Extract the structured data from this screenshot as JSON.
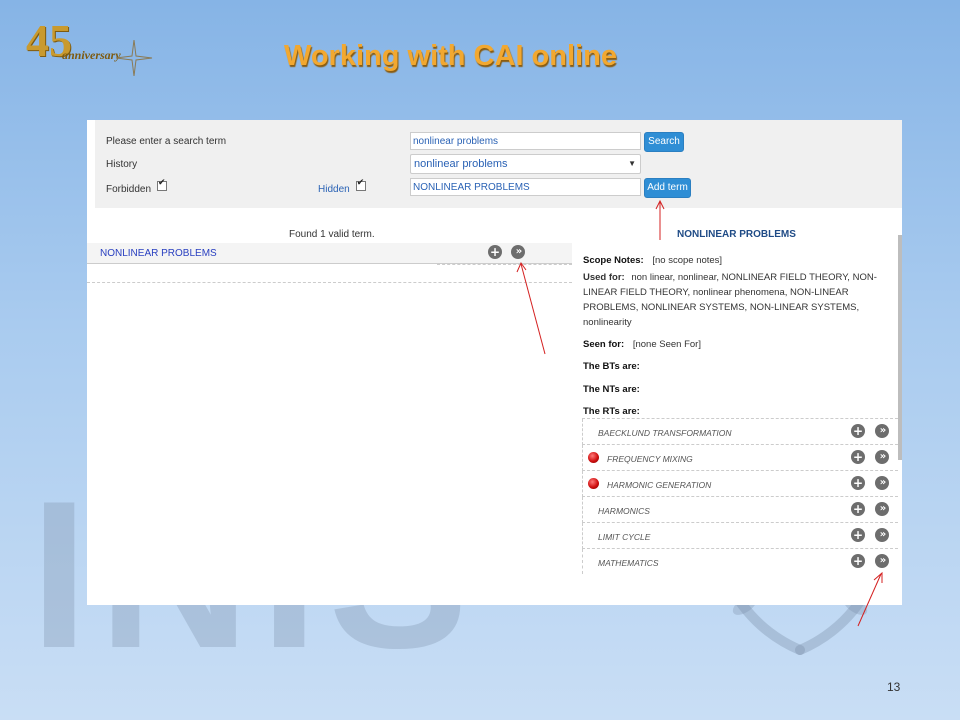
{
  "slide": {
    "title": "Working with CAI online",
    "page_number": "13"
  },
  "logo": {
    "number": "45",
    "word": "anniversary"
  },
  "background": {
    "letters": "INIS"
  },
  "search_form": {
    "search_label": "Please enter a search term",
    "search_value": "nonlinear problems",
    "search_button": "Search",
    "history_label": "History",
    "history_value": "nonlinear problems",
    "forbidden_label": "Forbidden",
    "hidden_label": "Hidden",
    "term_value": "NONLINEAR PROBLEMS",
    "add_term_button": "Add term"
  },
  "results": {
    "count_text": "Found 1 valid term.",
    "items": [
      {
        "label": "NONLINEAR PROBLEMS"
      }
    ]
  },
  "detail": {
    "title": "NONLINEAR PROBLEMS",
    "scope_notes_label": "Scope Notes:",
    "scope_notes_value": "[no scope notes]",
    "used_for_label": "Used for:",
    "used_for_value": "non linear, nonlinear, NONLINEAR FIELD THEORY, NON-LINEAR FIELD THEORY, nonlinear phenomena, NON-LINEAR PROBLEMS, NONLINEAR SYSTEMS, NON-LINEAR SYSTEMS, nonlinearity",
    "seen_for_label": "Seen for:",
    "seen_for_value": "[none Seen For]",
    "bts_label": "The BTs are:",
    "nts_label": "The NTs are:",
    "rts_label": "The RTs are:",
    "related_terms": [
      {
        "label": "BAECKLUND TRANSFORMATION",
        "forbidden": false
      },
      {
        "label": "FREQUENCY MIXING",
        "forbidden": true
      },
      {
        "label": "HARMONIC GENERATION",
        "forbidden": true
      },
      {
        "label": "HARMONICS",
        "forbidden": false
      },
      {
        "label": "LIMIT CYCLE",
        "forbidden": false
      },
      {
        "label": "MATHEMATICS",
        "forbidden": false
      }
    ]
  }
}
